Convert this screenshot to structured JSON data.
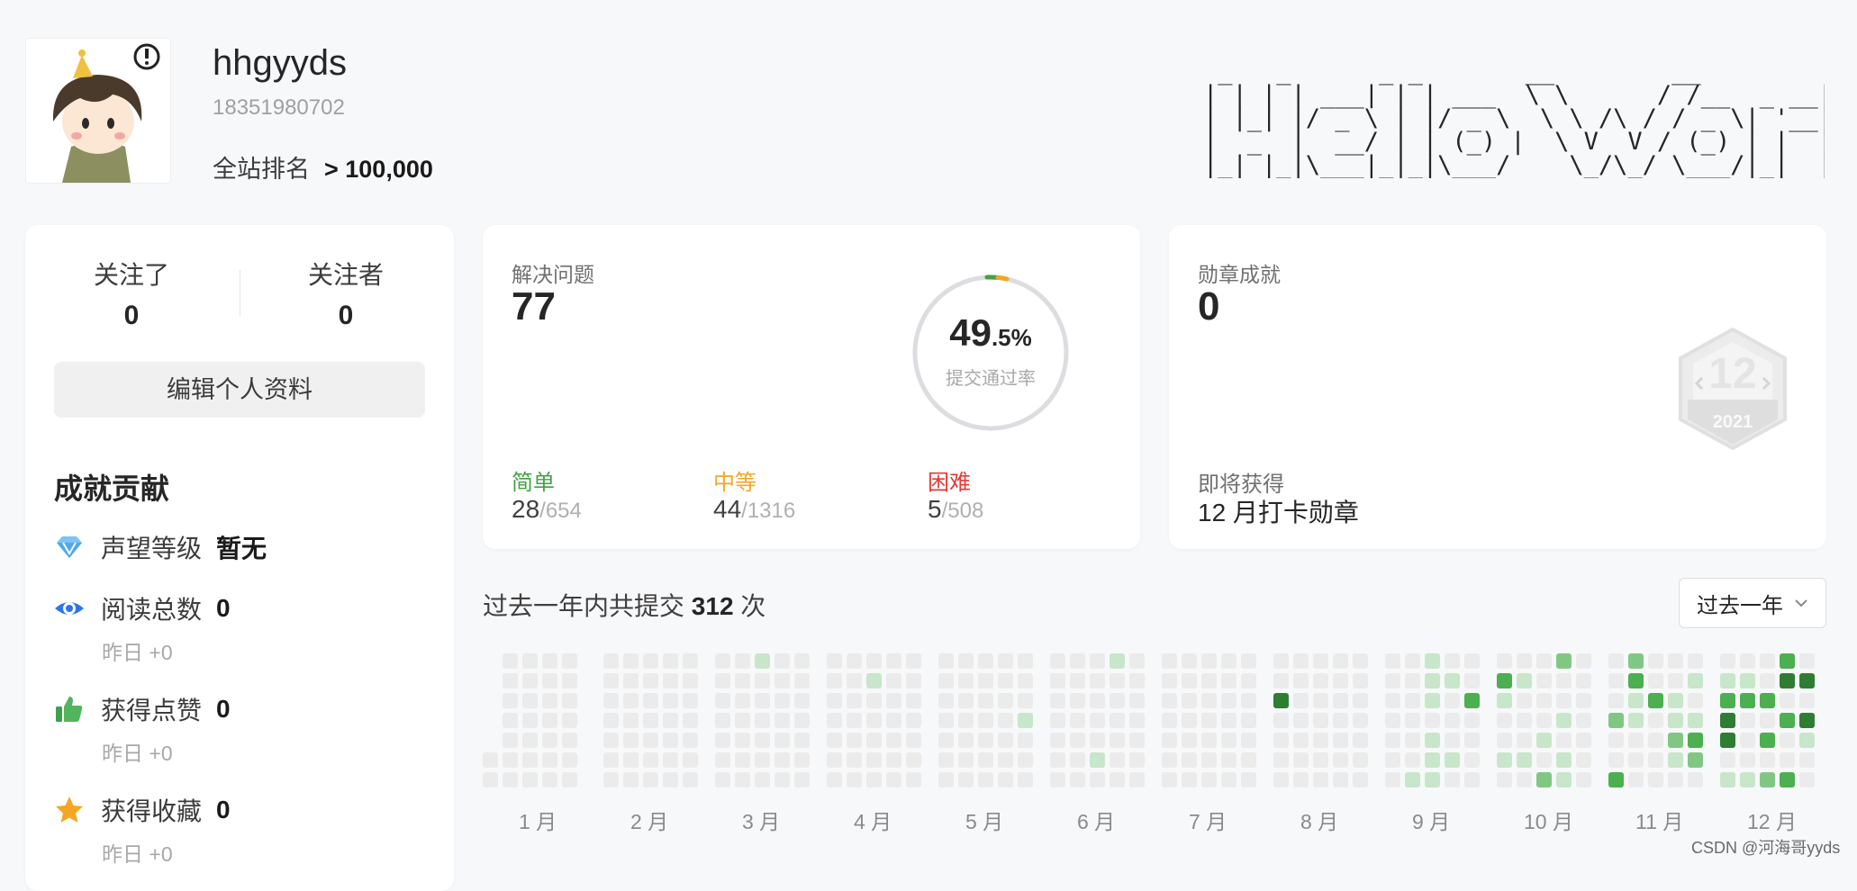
{
  "profile": {
    "username": "hhgyyds",
    "phone": "18351980702",
    "rank_label": "全站排名",
    "rank_value": "> 100,000"
  },
  "follow": {
    "following_label": "关注了",
    "following_value": "0",
    "followers_label": "关注者",
    "followers_value": "0"
  },
  "edit_button": "编辑个人资料",
  "contribution": {
    "title": "成就贡献",
    "items": [
      {
        "icon": "diamond-icon",
        "label": "声望等级",
        "value": "暂无"
      },
      {
        "icon": "eye-icon",
        "label": "阅读总数",
        "value": "0",
        "yesterday": "昨日 +0"
      },
      {
        "icon": "thumbs-up-icon",
        "label": "获得点赞",
        "value": "0",
        "yesterday": "昨日 +0"
      },
      {
        "icon": "star-icon",
        "label": "获得收藏",
        "value": "0",
        "yesterday": "昨日 +0"
      }
    ]
  },
  "solved": {
    "title": "解决问题",
    "count": "77",
    "rate_int": "49",
    "rate_dec": ".5%",
    "rate_label": "提交通过率",
    "easy_label": "简单",
    "easy_solved": "28",
    "easy_total": "/654",
    "medium_label": "中等",
    "medium_solved": "44",
    "medium_total": "/1316",
    "hard_label": "困难",
    "hard_solved": "5",
    "hard_total": "/508"
  },
  "badges": {
    "title": "勋章成就",
    "count": "0",
    "upcoming_label": "即将获得",
    "upcoming_name": "12 月打卡勋章",
    "badge_number": "12",
    "badge_year": "2021"
  },
  "submissions": {
    "prefix": "过去一年内共提交",
    "count": "312",
    "suffix": "次",
    "range_option": "过去一年",
    "months": [
      "1 月",
      "2 月",
      "3 月",
      "4 月",
      "5 月",
      "6 月",
      "7 月",
      "8 月",
      "9 月",
      "10 月",
      "11 月",
      "12 月"
    ]
  },
  "ascii_banner": {
    "lines": [
      " _   _      _ _       __        __         _     _ ",
      "| | | | ___| | | ___  \\ \\      / /__  _ __| | __| |",
      "| |_| |/ _ \\ | |/ _ \\  \\ \\ /\\ / / _ \\| '__| |/ _` |",
      "|  _  |  __/ | | (_) |  \\ V  V / (_) | |  | | (_| |",
      "|_| |_|\\___|_|_|\\___/    \\_/\\_/ \\___/|_|  |_|\\__,_|"
    ]
  },
  "watermark": "CSDN @河海哥yyds",
  "colors": {
    "easy": "#43a047",
    "medium": "#f5a623",
    "hard": "#e53935",
    "heat_empty": "#ebebeb",
    "heat_1": "#c8e6c9",
    "heat_2": "#81c784",
    "heat_3": "#4caf50",
    "heat_4": "#2e7d32"
  }
}
